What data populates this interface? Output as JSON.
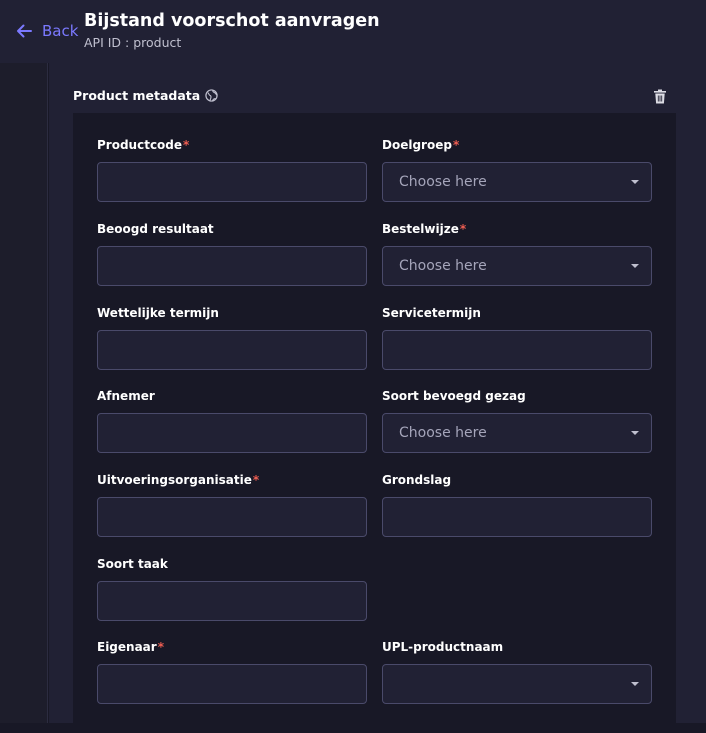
{
  "header": {
    "back_label": "Back",
    "title": "Bijstand voorschot aanvragen",
    "subtitle": "API ID : product"
  },
  "section": {
    "title": "Product metadata"
  },
  "colors": {
    "accent": "#7b79ff",
    "required": "#ee5e52",
    "background": "#181826",
    "surface": "#212134"
  },
  "fields": {
    "productcode": {
      "label": "Productcode",
      "required": "*",
      "value": ""
    },
    "doelgroep": {
      "label": "Doelgroep",
      "required": "*",
      "placeholder": "Choose here"
    },
    "beoogd_resultaat": {
      "label": "Beoogd resultaat",
      "value": ""
    },
    "bestelwijze": {
      "label": "Bestelwijze",
      "required": "*",
      "placeholder": "Choose here"
    },
    "wettelijke_termijn": {
      "label": "Wettelijke termijn",
      "value": ""
    },
    "servicetermijn": {
      "label": "Servicetermijn",
      "value": ""
    },
    "afnemer": {
      "label": "Afnemer",
      "value": ""
    },
    "soort_bevoegd_gezag": {
      "label": "Soort bevoegd gezag",
      "placeholder": "Choose here"
    },
    "uitvoeringsorganisatie": {
      "label": "Uitvoeringsorganisatie",
      "required": "*",
      "value": ""
    },
    "grondslag": {
      "label": "Grondslag",
      "value": ""
    },
    "soort_taak": {
      "label": "Soort taak",
      "value": ""
    },
    "eigenaar": {
      "label": "Eigenaar",
      "required": "*",
      "value": ""
    },
    "upl_productnaam": {
      "label": "UPL-productnaam",
      "placeholder": ""
    }
  }
}
